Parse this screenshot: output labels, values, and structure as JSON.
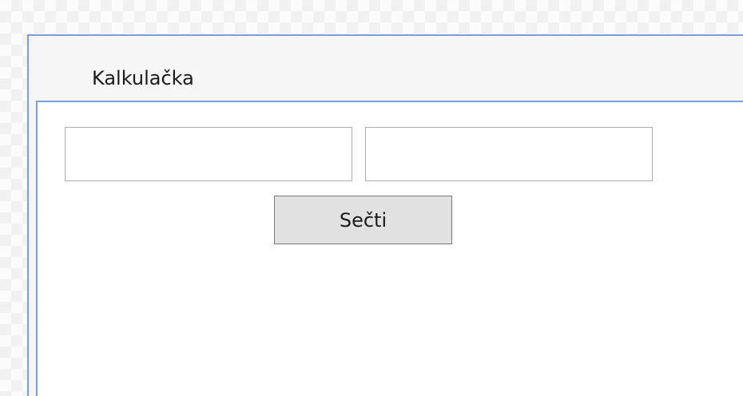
{
  "window": {
    "title": "Kalkulačka"
  },
  "form": {
    "input_a": {
      "value": "",
      "placeholder": ""
    },
    "input_b": {
      "value": "",
      "placeholder": ""
    },
    "add_button_label": "Sečti"
  },
  "colors": {
    "window_border": "#7a9fe0",
    "button_background": "#e1e1e1",
    "button_border": "#7a7a7a",
    "input_border": "#adadad"
  }
}
